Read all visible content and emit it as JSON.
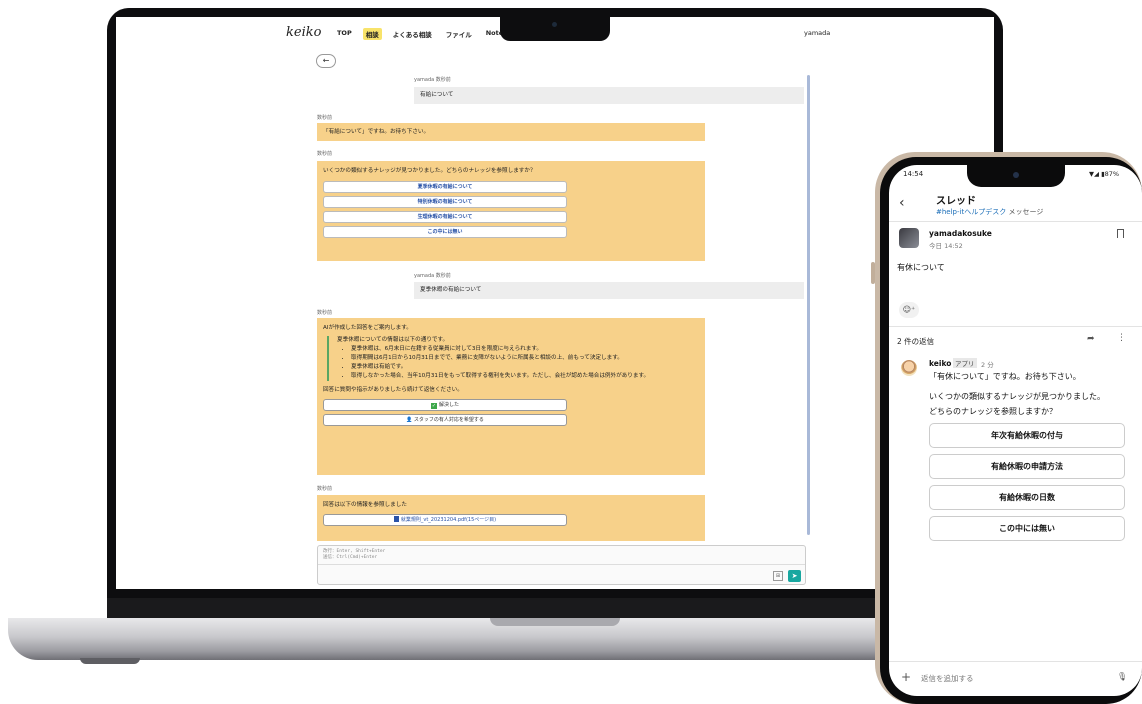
{
  "laptop": {
    "app": {
      "logo": "keiko",
      "nav": [
        "TOP",
        "相談",
        "よくある相談",
        "ファイル",
        "Note(s)"
      ],
      "active_nav": "相談",
      "user": "yamada",
      "back_symbol": "←"
    },
    "messages": {
      "m1_meta": "yamada  数秒前",
      "m1_text": "有給について",
      "b1_meta": "数秒前",
      "b1_text": "「有給について」ですね。お待ち下さい。",
      "b2_meta": "数秒前",
      "b2_text": "いくつかの類似するナレッジが見つかりました。どちらのナレッジを参照しますか？",
      "b2_options": [
        "夏季休暇の有給について",
        "特別休暇の有給について",
        "生理休暇の有給について",
        "この中には無い"
      ],
      "m2_meta": "yamada  数秒前",
      "m2_text": "夏季休暇の有給について",
      "b3_meta": "数秒前",
      "b3_intro": "AIが作成した回答をご案内します。",
      "b3_quote_title": "夏季休暇についての情報は以下の通りです。",
      "b3_bullets": [
        "夏季休暇は、6月末日に在籍する従業員に対して3日を限度に与えられます。",
        "取得期間は6月1日から10月31日までで、業務に支障がないように所属長と相談の上、前もって決定します。",
        "夏季休暇は有給です。",
        "取得しなかった場合、当年10月31日をもって取得する権利を失います。ただし、会社が認めた場合は例外があります。"
      ],
      "b3_followup": "回答に質問や指示がありましたら続けて返信ください。",
      "b3_resolved": "解決した",
      "b3_staff": "スタッフの有人対応を希望する",
      "b4_meta": "数秒前",
      "b4_text": "回答は以下の情報を参照しました",
      "b4_doc": "就業規則_vt_20231204.pdf(15ページ目)"
    },
    "composer": {
      "hint_line1": "改行：Enter, Shift+Enter",
      "hint_line2": "送信：Ctrl(Cmd)+Enter",
      "send_symbol": "➤",
      "attach_symbol": "⊞"
    }
  },
  "phone": {
    "status_time": "14:54",
    "status_right": "▼◢ ▮87%",
    "header_title": "スレッド",
    "header_channel": "#help-itヘルプデスク",
    "header_suffix": "メッセージ",
    "user_name": "yamadakosuke",
    "user_time": "今日 14:52",
    "user_message": "有休について",
    "reaction_icon": "☺⁺",
    "replies_label": "2 件の返信",
    "bot_name": "keiko",
    "bot_badge": "アプリ",
    "bot_time": "2 分",
    "bot_line1": "「有休について」ですね。お待ち下さい。",
    "bot_line2": "いくつかの類似するナレッジが見つかりました。",
    "bot_line3": "どちらのナレッジを参照しますか？",
    "buttons": [
      "年次有給休暇の付与",
      "有給休暇の申請方法",
      "有給休暇の日数",
      "この中には無い"
    ],
    "compose_placeholder": "返信を追加する"
  }
}
